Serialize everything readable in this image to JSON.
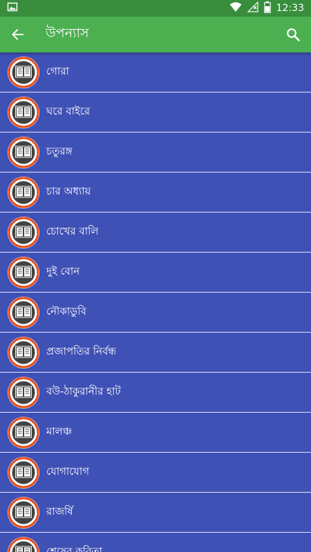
{
  "status_bar": {
    "time": "12:33",
    "icons": [
      "image-icon",
      "wifi-icon",
      "no-signal-icon",
      "battery-icon"
    ]
  },
  "app_bar": {
    "title": "উপন্যাস",
    "back_icon": "arrow-back-icon",
    "search_icon": "search-icon"
  },
  "colors": {
    "status_bar": "#388E3C",
    "app_bar": "#4CAF50",
    "list_background": "#3F51B5",
    "divider": "#E8EAF6",
    "icon_ring": "#E64A19",
    "icon_circle": "#424242"
  },
  "novels": [
    {
      "title": "গোরা"
    },
    {
      "title": "ঘরে বাইরে"
    },
    {
      "title": "চতুরঙ্গ"
    },
    {
      "title": "চার অধ্যায়"
    },
    {
      "title": "চোখের বালি"
    },
    {
      "title": "দুই বোন"
    },
    {
      "title": "নৌকাডুবি"
    },
    {
      "title": "প্রজাপতির নির্বন্ধ"
    },
    {
      "title": "বউ-ঠাকুরানীর হাট"
    },
    {
      "title": "মালঞ্চ"
    },
    {
      "title": "যোগাযোগ"
    },
    {
      "title": "রাজর্ষি"
    },
    {
      "title": "শেষের কবিতা"
    }
  ]
}
